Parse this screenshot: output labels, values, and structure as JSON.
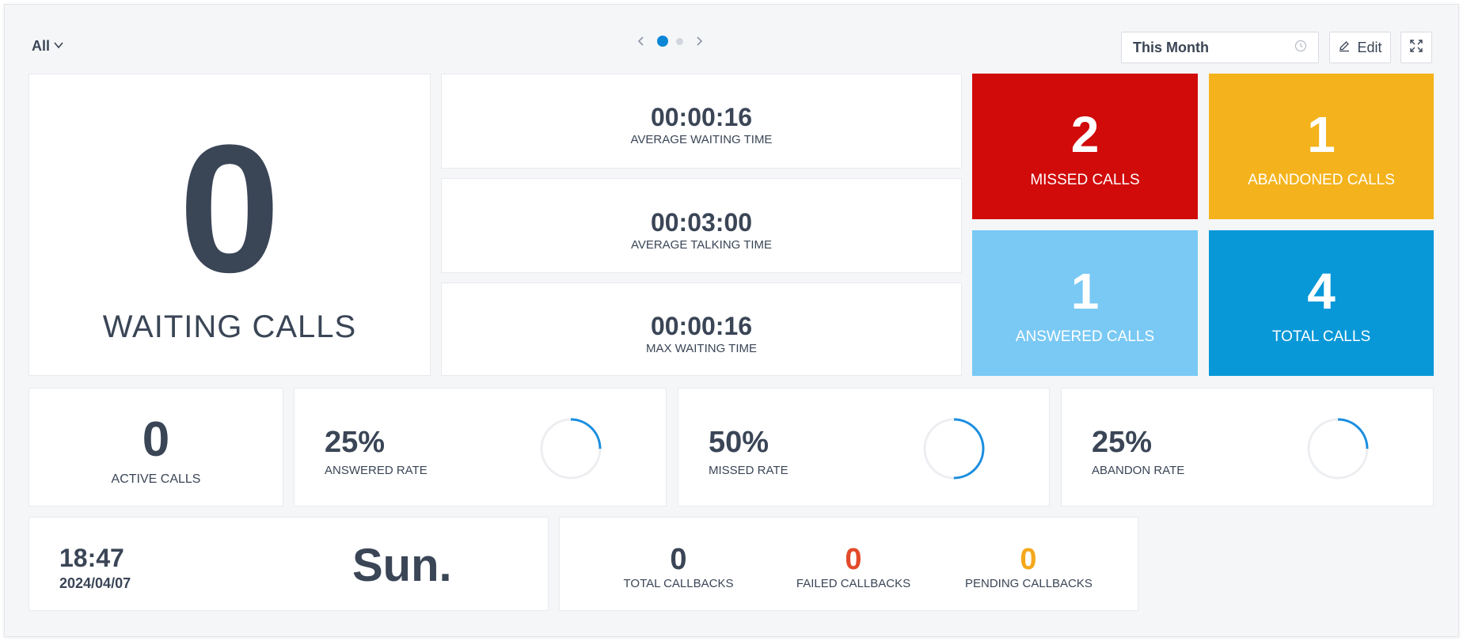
{
  "toolbar": {
    "filter_label": "All",
    "date_range": "This Month",
    "edit_label": "Edit"
  },
  "pager": {
    "current": 1,
    "total": 2
  },
  "waiting": {
    "value": "0",
    "label": "WAITING CALLS"
  },
  "times": [
    {
      "value": "00:00:16",
      "label": "AVERAGE WAITING TIME"
    },
    {
      "value": "00:03:00",
      "label": "AVERAGE TALKING TIME"
    },
    {
      "value": "00:00:16",
      "label": "MAX WAITING TIME"
    }
  ],
  "tiles": {
    "missed": {
      "value": "2",
      "label": "MISSED CALLS",
      "color": "#d10a0a"
    },
    "abandoned": {
      "value": "1",
      "label": "ABANDONED CALLS",
      "color": "#f4b31c"
    },
    "answered": {
      "value": "1",
      "label": "ANSWERED CALLS",
      "color": "#79c9f4"
    },
    "total": {
      "value": "4",
      "label": "TOTAL CALLS",
      "color": "#0898d8"
    }
  },
  "active": {
    "value": "0",
    "label": "ACTIVE CALLS"
  },
  "rates": [
    {
      "value": "25%",
      "label": "ANSWERED RATE",
      "fraction": 0.25
    },
    {
      "value": "50%",
      "label": "MISSED RATE",
      "fraction": 0.5
    },
    {
      "value": "25%",
      "label": "ABANDON RATE",
      "fraction": 0.25
    }
  ],
  "clock": {
    "time": "18:47",
    "date": "2024/04/07",
    "day": "Sun."
  },
  "callbacks": [
    {
      "value": "0",
      "label": "TOTAL CALLBACKS",
      "color": "#3a4556"
    },
    {
      "value": "0",
      "label": "FAILED CALLBACKS",
      "color": "#e24a2a"
    },
    {
      "value": "0",
      "label": "PENDING CALLBACKS",
      "color": "#f4a81c"
    }
  ],
  "colors": {
    "accent": "#1a8ee0",
    "ring_track": "#eceef1"
  }
}
